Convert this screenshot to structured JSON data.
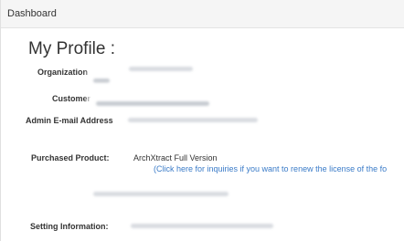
{
  "header": {
    "title": "Dashboard"
  },
  "page": {
    "title": "My Profile :"
  },
  "fields": {
    "organization": {
      "label": "Organization"
    },
    "customer": {
      "label": "Customer"
    },
    "admin_email": {
      "label": "Admin E-mail Address"
    },
    "purchased_product": {
      "label": "Purchased Product:",
      "value": "ArchXtract Full Version",
      "renew_link": "(Click here for inquiries if you want to renew the license of the fo"
    },
    "setting_information": {
      "label": "Setting Information:"
    }
  },
  "colors": {
    "link": "#3a7bc8",
    "header_bg": "#f5f5f5",
    "redacted": "#c8ccd2"
  }
}
